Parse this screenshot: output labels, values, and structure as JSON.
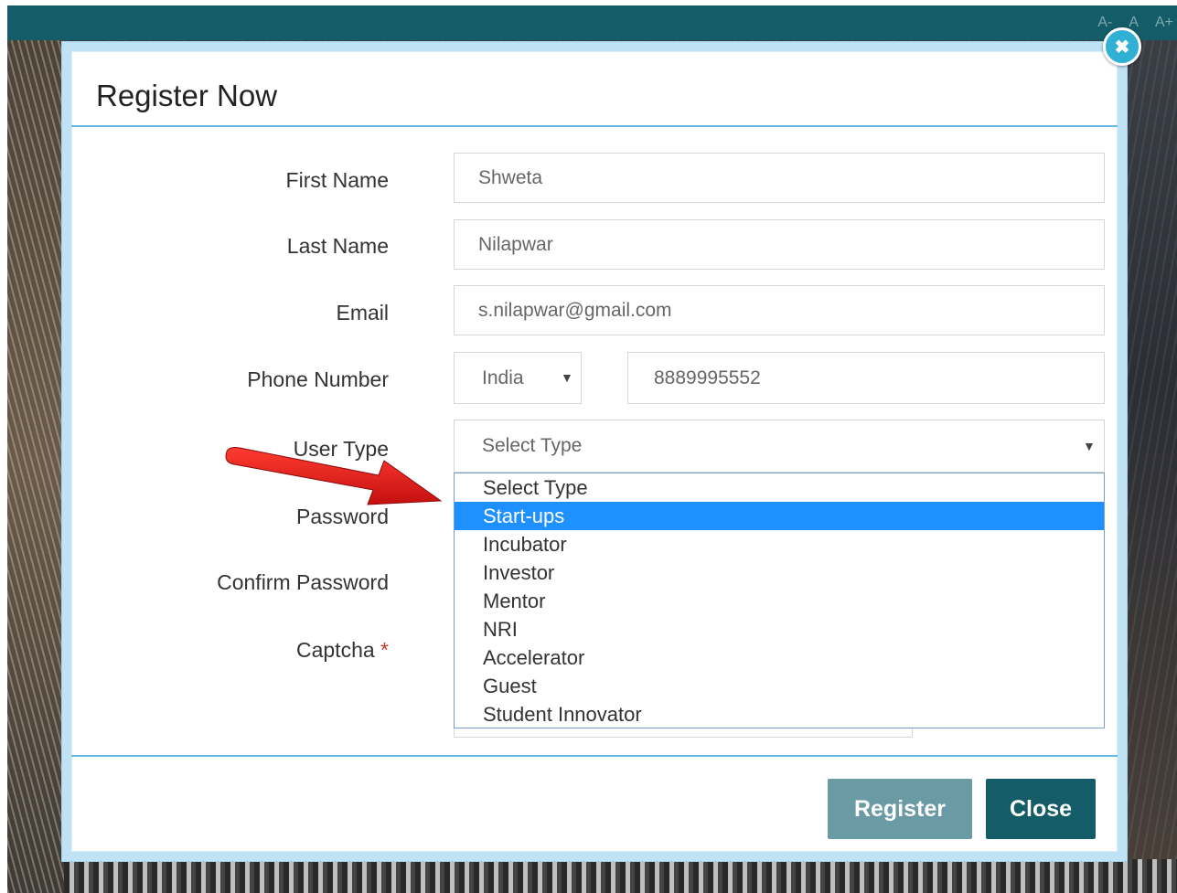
{
  "topbar": {
    "font_controls": [
      "A-",
      "A",
      "A+"
    ]
  },
  "modal": {
    "title": "Register Now",
    "close_icon": "close-icon"
  },
  "form": {
    "first_name": {
      "label": "First Name",
      "value": "Shweta"
    },
    "last_name": {
      "label": "Last Name",
      "value": "Nilapwar"
    },
    "email": {
      "label": "Email",
      "value": "s.nilapwar@gmail.com"
    },
    "phone": {
      "label": "Phone Number",
      "country": "India",
      "value": "8889995552"
    },
    "user_type": {
      "label": "User Type",
      "value": "Select Type"
    },
    "password": {
      "label": "Password"
    },
    "confirm_password": {
      "label": "Confirm Password"
    },
    "captcha": {
      "label": "Captcha",
      "required_mark": "*"
    }
  },
  "dropdown": {
    "options": [
      "Select Type",
      "Start-ups",
      "Incubator",
      "Investor",
      "Mentor",
      "NRI",
      "Accelerator",
      "Guest",
      "Student Innovator"
    ],
    "highlighted": "Start-ups"
  },
  "buttons": {
    "register": "Register",
    "close": "Close"
  },
  "colors": {
    "header_bar": "#135c68",
    "accent_line": "#62b8e0",
    "highlight": "#1e90ff",
    "annotation_arrow": "#e02020"
  }
}
